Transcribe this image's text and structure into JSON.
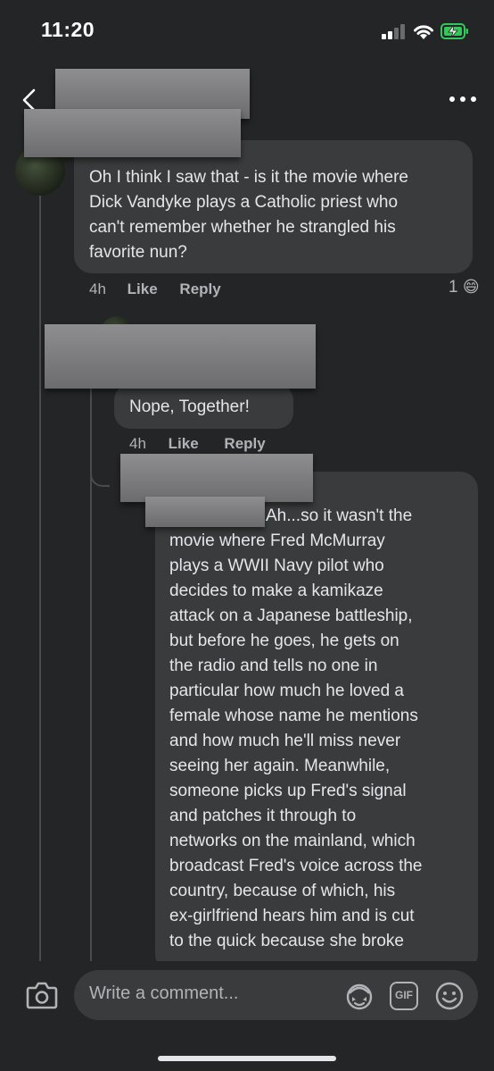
{
  "status": {
    "time": "11:20"
  },
  "comments": [
    {
      "text_lines": [
        "Oh I think I saw that - is it the movie where",
        "Dick Vandyke plays a Catholic priest who",
        "can't remember whether he strangled his",
        "favorite nun?"
      ],
      "time": "4h",
      "like_label": "Like",
      "reply_label": "Reply",
      "reaction_count": "1",
      "reaction_emoji": "😄"
    },
    {
      "text": "Nope, Together!",
      "time": "4h",
      "like_label": "Like",
      "reply_label": "Reply"
    },
    {
      "first_line": "Ah...so it wasn't the",
      "text_lines": [
        "movie where Fred McMurray",
        "plays a WWII Navy pilot who",
        "decides to make a kamikaze",
        "attack on a Japanese battleship,",
        "but before he goes, he gets on",
        "the radio and tells no one in",
        "particular how much he loved a",
        "female whose name he mentions",
        "and how much he'll miss never",
        "seeing her again. Meanwhile,",
        "someone picks up Fred's signal",
        "and patches it through to",
        "networks on the mainland, which",
        "broadcast Fred's voice across the",
        "country, because of which, his",
        "ex-girlfriend hears him and is cut",
        "to the quick because she broke"
      ]
    }
  ],
  "composer": {
    "placeholder": "Write a comment...",
    "gif_label": "GIF"
  }
}
